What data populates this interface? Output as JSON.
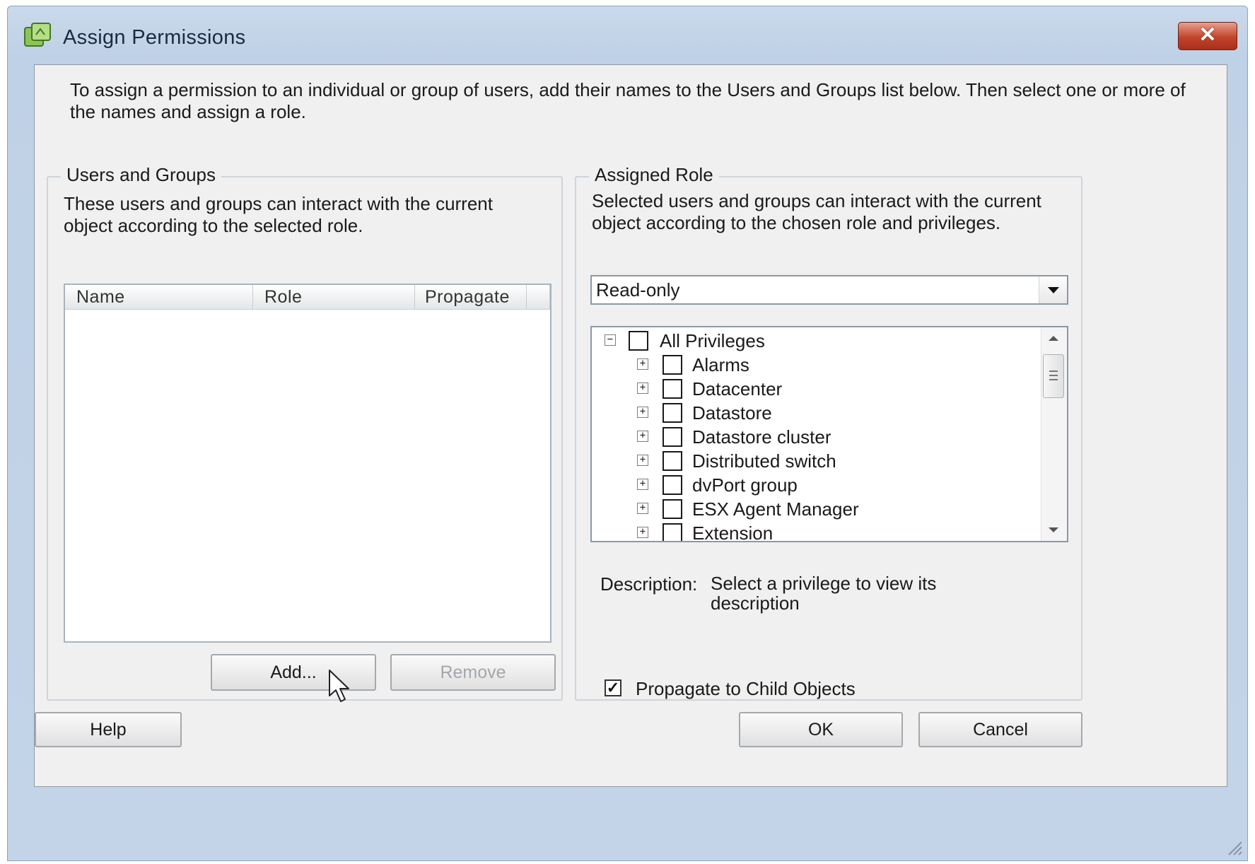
{
  "window": {
    "title": "Assign Permissions",
    "close_glyph": "✕"
  },
  "intro": "To assign a permission to an individual or group of users, add their names to the Users and Groups list below. Then select one or more of the names and assign a role.",
  "users_groups": {
    "legend": "Users and Groups",
    "description": "These users and groups can interact with the current object according to the selected role.",
    "columns": [
      "Name",
      "Role",
      "Propagate"
    ],
    "add_label": "Add...",
    "remove_label": "Remove"
  },
  "assigned_role": {
    "legend": "Assigned Role",
    "description": "Selected users and groups can interact with the current object according to the chosen role and privileges.",
    "selected_role": "Read-only",
    "privileges": {
      "root": "All Privileges",
      "items": [
        "Alarms",
        "Datacenter",
        "Datastore",
        "Datastore cluster",
        "Distributed switch",
        "dvPort group",
        "ESX Agent Manager",
        "Extension"
      ]
    },
    "description_label": "Description:",
    "description_text": "Select a privilege to view its description",
    "propagate_label": "Propagate to Child Objects",
    "propagate_checked": true
  },
  "footer": {
    "help_label": "Help",
    "ok_label": "OK",
    "cancel_label": "Cancel"
  },
  "icons": {
    "title": "permissions-icon",
    "close": "close-icon",
    "dropdown": "chevron-down-icon",
    "tree_expand": "plus-box-icon",
    "tree_collapse": "minus-box-icon",
    "cursor": "mouse-pointer-icon"
  },
  "colors": {
    "close_button": "#c2442b",
    "title_bar": "#c3d4e8",
    "dialog_body": "#f0f0f0"
  }
}
